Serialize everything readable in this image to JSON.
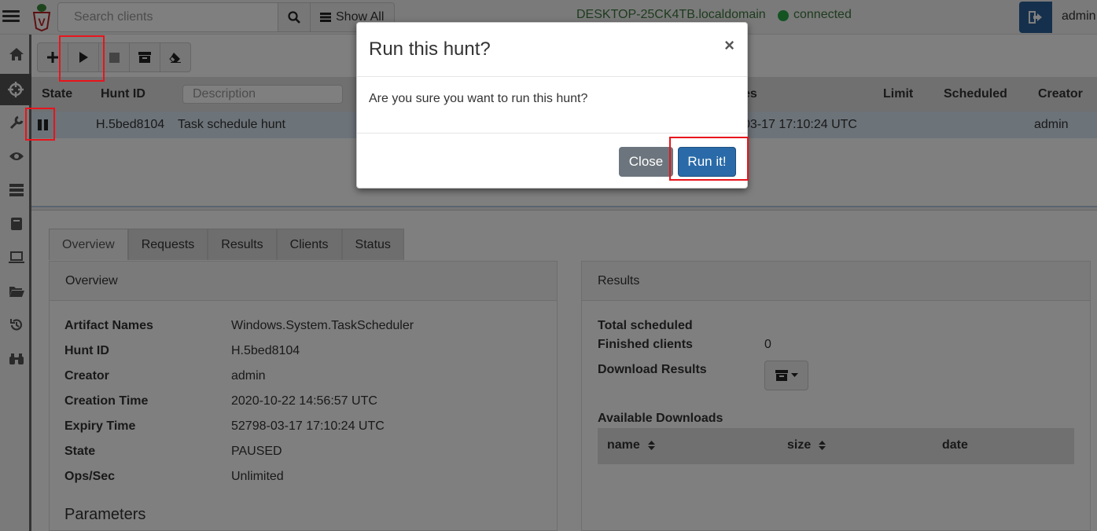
{
  "topbar": {
    "search_placeholder": "Search clients",
    "show_all_label": "Show All",
    "hostname": "DESKTOP-25CK4TB.localdomain",
    "connection_status": "connected",
    "user": "admin"
  },
  "hunts_table": {
    "columns": {
      "state": "State",
      "hunt_id": "Hunt ID",
      "description_filter_placeholder": "Description",
      "expires": "es",
      "limit": "Limit",
      "scheduled": "Scheduled",
      "creator": "Creator"
    },
    "row": {
      "state_icon": "pause-icon",
      "hunt_id": "H.5bed8104",
      "description": "Task schedule hunt",
      "expires": "03-17 17:10:24 UTC",
      "creator": "admin"
    }
  },
  "tabs": [
    "Overview",
    "Requests",
    "Results",
    "Clients",
    "Status"
  ],
  "overview": {
    "heading": "Overview",
    "fields": [
      {
        "key": "Artifact Names",
        "value": "Windows.System.TaskScheduler"
      },
      {
        "key": "Hunt ID",
        "value": "H.5bed8104"
      },
      {
        "key": "Creator",
        "value": "admin"
      },
      {
        "key": "Creation Time",
        "value": "2020-10-22 14:56:57 UTC"
      },
      {
        "key": "Expiry Time",
        "value": "52798-03-17 17:10:24 UTC"
      },
      {
        "key": "State",
        "value": "PAUSED"
      },
      {
        "key": "Ops/Sec",
        "value": "Unlimited"
      }
    ],
    "parameters_title": "Parameters"
  },
  "results": {
    "heading": "Results",
    "total_scheduled_label": "Total scheduled",
    "finished_clients_label": "Finished clients",
    "finished_clients_value": "0",
    "download_results_label": "Download Results",
    "available_downloads_label": "Available Downloads",
    "downloads_columns": [
      "name",
      "size",
      "date"
    ]
  },
  "modal": {
    "title": "Run this hunt?",
    "close_x": "×",
    "body": "Are you sure you want to run this hunt?",
    "close_button": "Close",
    "run_button": "Run it!"
  },
  "colors": {
    "primary": "#2a6aa8",
    "secondary": "#6c757d",
    "connected": "#28a745",
    "highlight": "#e8141c",
    "selected_row": "#d9e6f2"
  }
}
